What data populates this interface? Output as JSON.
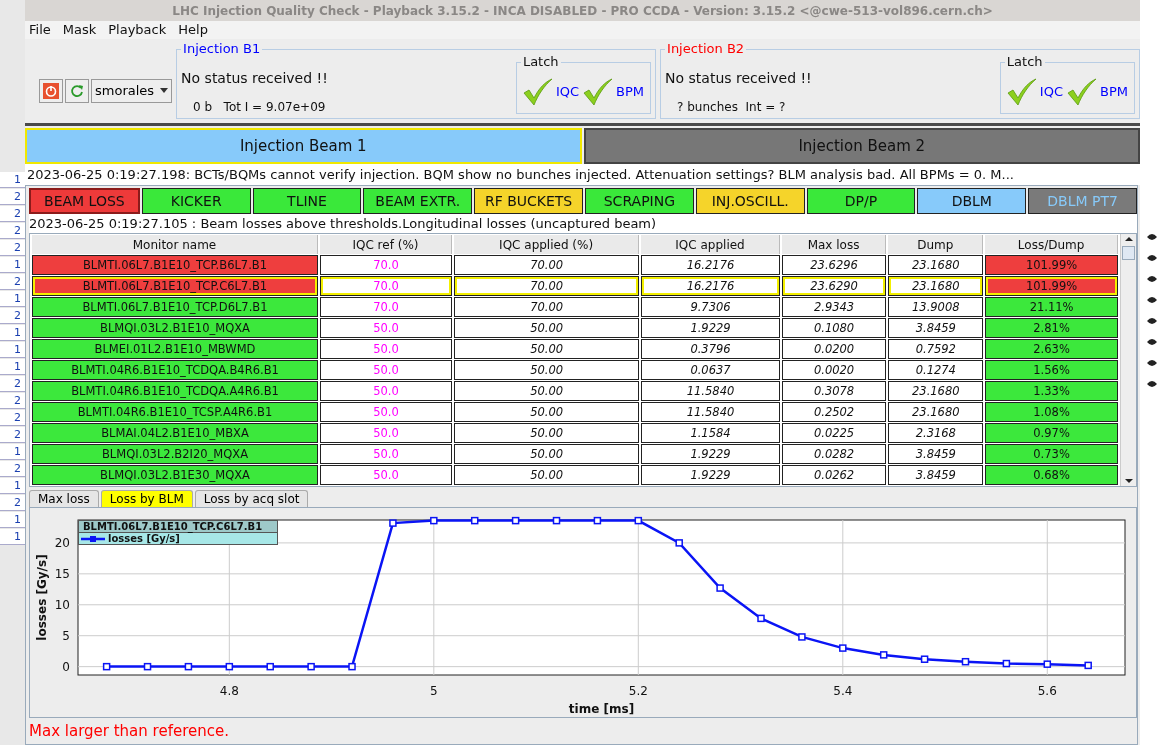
{
  "window": {
    "title": "LHC Injection Quality Check - Playback 3.15.2 -  INCA DISABLED - PRO CCDA - Version: 3.15.2 <@cwe-513-vol896.cern.ch>"
  },
  "menu": [
    "File",
    "Mask",
    "Playback",
    "Help"
  ],
  "toolbar": {
    "user": "smorales"
  },
  "injections": [
    {
      "title": "Injection B1",
      "color": "#0000ff",
      "status": "No status received !!",
      "info": "0 b   Tot I = 9.07e+09",
      "latch_title": "Latch",
      "latches": [
        {
          "label": "IQC",
          "checked": true
        },
        {
          "label": "BPM",
          "checked": true
        }
      ]
    },
    {
      "title": "Injection B2",
      "color": "#ff0000",
      "status": "No status received !!",
      "info": "? bunches  Int = ?",
      "latch_title": "Latch",
      "latches": [
        {
          "label": "IQC",
          "checked": true
        },
        {
          "label": "BPM",
          "checked": true
        }
      ]
    }
  ],
  "beam_tabs": [
    {
      "label": "Injection Beam 1",
      "selected": true
    },
    {
      "label": "Injection Beam 2",
      "selected": false
    }
  ],
  "summary": "2023-06-25 0:19:27.198: BCTs/BQMs cannot verify injection. BQM show no bunches injected. Attenuation settings? BLM analysis bad. All BPMs = 0. M...",
  "checks": [
    {
      "label": "BEAM LOSS",
      "color": "#ee3a3a",
      "selected": true
    },
    {
      "label": "KICKER",
      "color": "#3ae83a",
      "selected": false
    },
    {
      "label": "TLINE",
      "color": "#3ae83a",
      "selected": false
    },
    {
      "label": "BEAM EXTR.",
      "color": "#3ae83a",
      "selected": false
    },
    {
      "label": "RF BUCKETS",
      "color": "#f5d42a",
      "selected": false
    },
    {
      "label": "SCRAPING",
      "color": "#3ae83a",
      "selected": false
    },
    {
      "label": "INJ.OSCILL.",
      "color": "#f5d42a",
      "selected": false
    },
    {
      "label": "DP/P",
      "color": "#3ae83a",
      "selected": false
    },
    {
      "label": "DBLM",
      "color": "#87cafa",
      "selected": false
    },
    {
      "label": "DBLM PT7",
      "color": "#7a7a7a",
      "selected": false
    }
  ],
  "detail": "2023-06-25 0:19:27.105 : Beam losses above thresholds.Longitudinal losses (uncaptured beam)",
  "table": {
    "columns": [
      "Monitor name",
      "IQC ref (%)",
      "IQC applied (%)",
      "IQC applied",
      "Max loss",
      "Dump",
      "Loss/Dump"
    ],
    "rows": [
      {
        "color": "#ee3e3e",
        "selected": false,
        "cells": [
          "BLMTI.06L7.B1E10_TCP.B6L7.B1",
          "70.0",
          "70.00",
          "16.2176",
          "23.6296",
          "23.1680",
          "101.99%"
        ]
      },
      {
        "color": "#ee3e3e",
        "selected": true,
        "cells": [
          "BLMTI.06L7.B1E10_TCP.C6L7.B1",
          "70.0",
          "70.00",
          "16.2176",
          "23.6290",
          "23.1680",
          "101.99%"
        ]
      },
      {
        "color": "#3ce83c",
        "selected": false,
        "cells": [
          "BLMTI.06L7.B1E10_TCP.D6L7.B1",
          "70.0",
          "70.00",
          "9.7306",
          "2.9343",
          "13.9008",
          "21.11%"
        ]
      },
      {
        "color": "#3ce83c",
        "selected": false,
        "cells": [
          "BLMQI.03L2.B1E10_MQXA",
          "50.0",
          "50.00",
          "1.9229",
          "0.1080",
          "3.8459",
          "2.81%"
        ]
      },
      {
        "color": "#3ce83c",
        "selected": false,
        "cells": [
          "BLMEI.01L2.B1E10_MBWMD",
          "50.0",
          "50.00",
          "0.3796",
          "0.0200",
          "0.7592",
          "2.63%"
        ]
      },
      {
        "color": "#3ce83c",
        "selected": false,
        "cells": [
          "BLMTI.04R6.B1E10_TCDQA.B4R6.B1",
          "50.0",
          "50.00",
          "0.0637",
          "0.0020",
          "0.1274",
          "1.56%"
        ]
      },
      {
        "color": "#3ce83c",
        "selected": false,
        "cells": [
          "BLMTI.04R6.B1E10_TCDQA.A4R6.B1",
          "50.0",
          "50.00",
          "11.5840",
          "0.3078",
          "23.1680",
          "1.33%"
        ]
      },
      {
        "color": "#3ce83c",
        "selected": false,
        "cells": [
          "BLMTI.04R6.B1E10_TCSP.A4R6.B1",
          "50.0",
          "50.00",
          "11.5840",
          "0.2502",
          "23.1680",
          "1.08%"
        ]
      },
      {
        "color": "#3ce83c",
        "selected": false,
        "cells": [
          "BLMAI.04L2.B1E10_MBXA",
          "50.0",
          "50.00",
          "1.1584",
          "0.0225",
          "2.3168",
          "0.97%"
        ]
      },
      {
        "color": "#3ce83c",
        "selected": false,
        "cells": [
          "BLMQI.03L2.B2I20_MQXA",
          "50.0",
          "50.00",
          "1.9229",
          "0.0282",
          "3.8459",
          "0.73%"
        ]
      },
      {
        "color": "#3ce83c",
        "selected": false,
        "cells": [
          "BLMQI.03L2.B1E30_MQXA",
          "50.0",
          "50.00",
          "1.9229",
          "0.0262",
          "3.8459",
          "0.68%"
        ]
      }
    ]
  },
  "plot_tabs": [
    {
      "label": "Max loss",
      "selected": false
    },
    {
      "label": "Loss by BLM",
      "selected": true
    },
    {
      "label": "Loss by acq slot",
      "selected": false
    }
  ],
  "chart": {
    "legend_title": "BLMTI.06L7.B1E10_TCP.C6L7.B1",
    "chart_data": {
      "type": "line",
      "xlabel": "time [ms]",
      "ylabel": "losses [Gy/s]",
      "x": [
        4.68,
        4.72,
        4.76,
        4.8,
        4.84,
        4.88,
        4.92,
        4.96,
        5.0,
        5.04,
        5.08,
        5.12,
        5.16,
        5.2,
        5.24,
        5.28,
        5.32,
        5.36,
        5.4,
        5.44,
        5.48,
        5.52,
        5.56,
        5.6,
        5.64
      ],
      "series": [
        {
          "name": "losses [Gy/s]",
          "color": "#0a14f5",
          "marker": "square",
          "values": [
            0,
            0,
            0,
            0,
            0,
            0,
            0,
            23.2,
            23.6,
            23.6,
            23.6,
            23.6,
            23.6,
            23.6,
            20.0,
            12.7,
            7.8,
            4.8,
            3.0,
            1.9,
            1.2,
            0.8,
            0.5,
            0.4,
            0.2
          ]
        }
      ],
      "grid": true,
      "xlim": [
        4.652,
        5.676
      ],
      "ylim": [
        -1.35,
        23.7
      ],
      "xticks": [
        4.8,
        5,
        5.2,
        5.4,
        5.6
      ],
      "yticks": [
        0,
        5,
        10,
        15,
        20
      ]
    }
  },
  "message": "Max larger than reference.",
  "background_window": {
    "left_texts": [
      "1",
      "2",
      "2",
      "2",
      "2",
      "1",
      "2",
      "1",
      "2",
      "1",
      "1",
      "1",
      "2",
      "2",
      "2",
      "2",
      "1",
      "2",
      "1",
      "2",
      "1",
      "1"
    ]
  }
}
